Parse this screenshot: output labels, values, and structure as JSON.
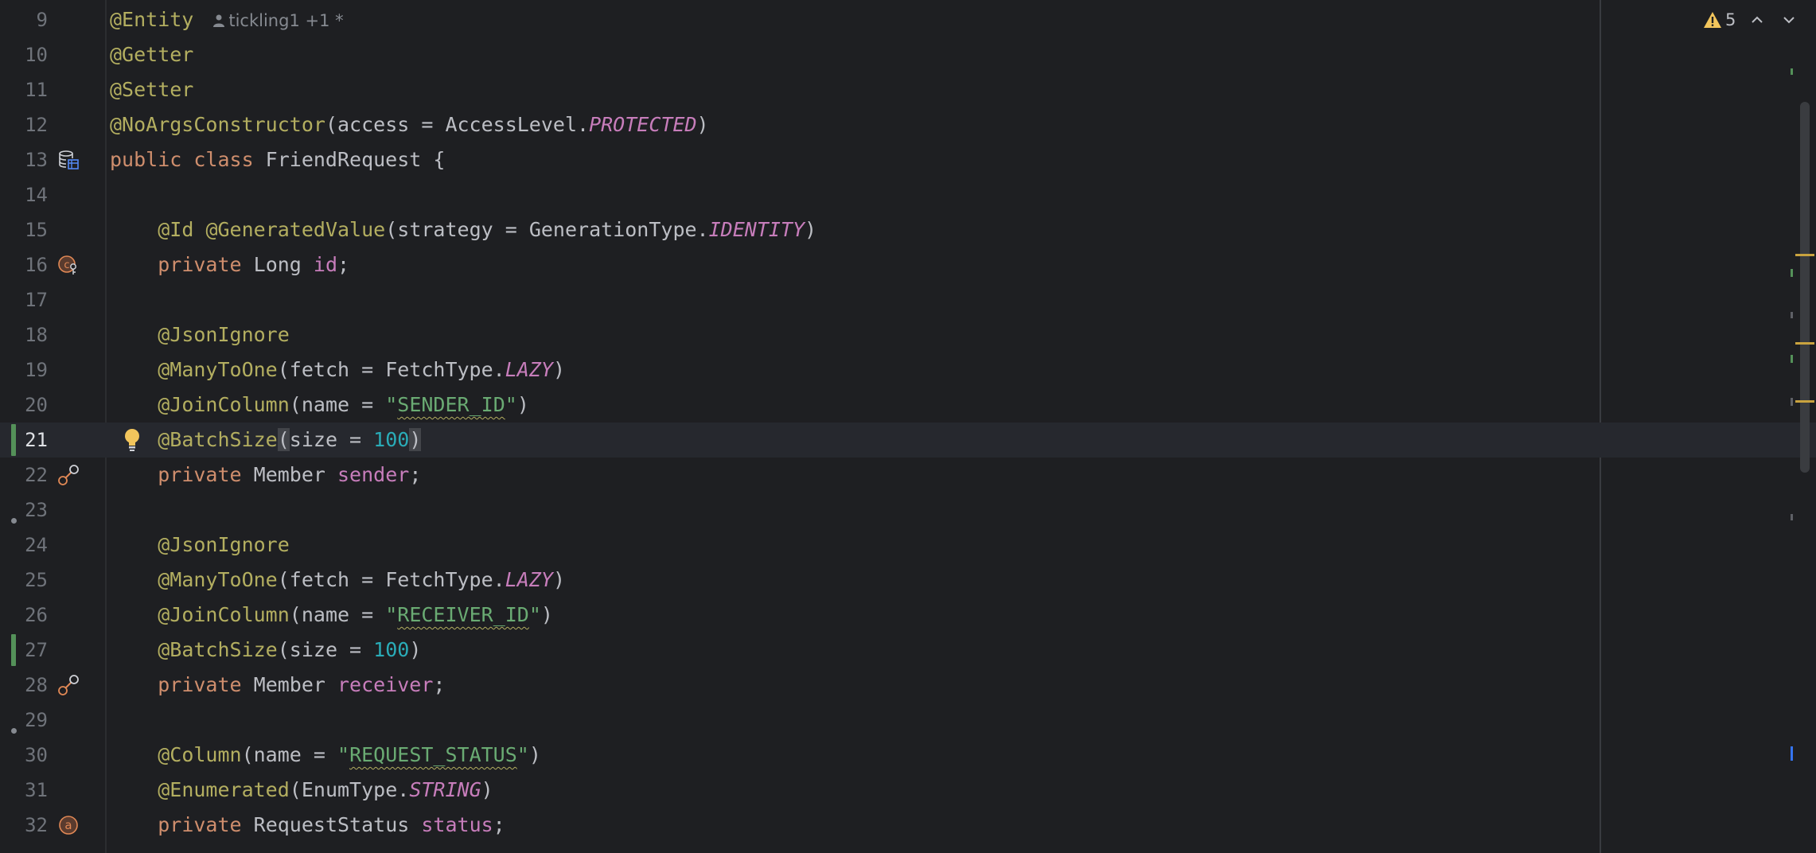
{
  "inlay_hint": "tickling1 +1 *",
  "inspections": {
    "warning_count": "5"
  },
  "lines": [
    {
      "n": "9",
      "tokens": [
        {
          "t": "@Entity",
          "c": "ann"
        }
      ],
      "inlay": true
    },
    {
      "n": "10",
      "tokens": [
        {
          "t": "@Getter",
          "c": "ann"
        }
      ]
    },
    {
      "n": "11",
      "tokens": [
        {
          "t": "@Setter",
          "c": "ann"
        }
      ]
    },
    {
      "n": "12",
      "tokens": [
        {
          "t": "@NoArgsConstructor",
          "c": "ann"
        },
        {
          "t": "(access = AccessLevel.",
          "c": "pun"
        },
        {
          "t": "PROTECTED",
          "c": "enm"
        },
        {
          "t": ")",
          "c": "pun"
        }
      ]
    },
    {
      "n": "13",
      "tokens": [
        {
          "t": "public ",
          "c": "kw"
        },
        {
          "t": "class ",
          "c": "kw"
        },
        {
          "t": "FriendRequest {",
          "c": "cls"
        }
      ],
      "icon": "database-entity-icon"
    },
    {
      "n": "14",
      "tokens": []
    },
    {
      "n": "15",
      "tokens": [
        {
          "t": "    "
        },
        {
          "t": "@Id ",
          "c": "ann"
        },
        {
          "t": "@GeneratedValue",
          "c": "ann"
        },
        {
          "t": "(strategy = GenerationType.",
          "c": "pun"
        },
        {
          "t": "IDENTITY",
          "c": "enm"
        },
        {
          "t": ")",
          "c": "pun"
        }
      ]
    },
    {
      "n": "16",
      "tokens": [
        {
          "t": "    "
        },
        {
          "t": "private ",
          "c": "kw"
        },
        {
          "t": "Long ",
          "c": "cls"
        },
        {
          "t": "id",
          "c": "fld"
        },
        {
          "t": ";",
          "c": "pun"
        }
      ],
      "icon": "id-key-icon"
    },
    {
      "n": "17",
      "tokens": []
    },
    {
      "n": "18",
      "tokens": [
        {
          "t": "    "
        },
        {
          "t": "@JsonIgnore",
          "c": "ann"
        }
      ]
    },
    {
      "n": "19",
      "tokens": [
        {
          "t": "    "
        },
        {
          "t": "@ManyToOne",
          "c": "ann"
        },
        {
          "t": "(fetch = FetchType.",
          "c": "pun"
        },
        {
          "t": "LAZY",
          "c": "enm"
        },
        {
          "t": ")",
          "c": "pun"
        }
      ]
    },
    {
      "n": "20",
      "tokens": [
        {
          "t": "    "
        },
        {
          "t": "@JoinColumn",
          "c": "ann"
        },
        {
          "t": "(name = ",
          "c": "pun"
        },
        {
          "t": "\"",
          "c": "str"
        },
        {
          "t": "SENDER_ID",
          "c": "str squig"
        },
        {
          "t": "\"",
          "c": "str"
        },
        {
          "t": ")",
          "c": "pun"
        }
      ]
    },
    {
      "n": "21",
      "tokens": [
        {
          "t": "    "
        },
        {
          "t": "@BatchSize",
          "c": "ann"
        },
        {
          "t": "(",
          "c": "pun bracket-hl"
        },
        {
          "t": "size = ",
          "c": "pun"
        },
        {
          "t": "100",
          "c": "num"
        },
        {
          "t": ")",
          "c": "pun bracket-hl"
        }
      ],
      "current": true,
      "changed": true,
      "bulb": true
    },
    {
      "n": "22",
      "tokens": [
        {
          "t": "    "
        },
        {
          "t": "private ",
          "c": "kw"
        },
        {
          "t": "Member ",
          "c": "cls"
        },
        {
          "t": "sender",
          "c": "fld"
        },
        {
          "t": ";",
          "c": "pun"
        }
      ],
      "icon": "relation-link-icon"
    },
    {
      "n": "23",
      "tokens": [],
      "dot": true
    },
    {
      "n": "24",
      "tokens": [
        {
          "t": "    "
        },
        {
          "t": "@JsonIgnore",
          "c": "ann"
        }
      ]
    },
    {
      "n": "25",
      "tokens": [
        {
          "t": "    "
        },
        {
          "t": "@ManyToOne",
          "c": "ann"
        },
        {
          "t": "(fetch = FetchType.",
          "c": "pun"
        },
        {
          "t": "LAZY",
          "c": "enm"
        },
        {
          "t": ")",
          "c": "pun"
        }
      ]
    },
    {
      "n": "26",
      "tokens": [
        {
          "t": "    "
        },
        {
          "t": "@JoinColumn",
          "c": "ann"
        },
        {
          "t": "(name = ",
          "c": "pun"
        },
        {
          "t": "\"",
          "c": "str"
        },
        {
          "t": "RECEIVER_ID",
          "c": "str squig"
        },
        {
          "t": "\"",
          "c": "str"
        },
        {
          "t": ")",
          "c": "pun"
        }
      ]
    },
    {
      "n": "27",
      "tokens": [
        {
          "t": "    "
        },
        {
          "t": "@BatchSize",
          "c": "ann"
        },
        {
          "t": "(size = ",
          "c": "pun"
        },
        {
          "t": "100",
          "c": "num"
        },
        {
          "t": ")",
          "c": "pun"
        }
      ],
      "changed": true
    },
    {
      "n": "28",
      "tokens": [
        {
          "t": "    "
        },
        {
          "t": "private ",
          "c": "kw"
        },
        {
          "t": "Member ",
          "c": "cls"
        },
        {
          "t": "receiver",
          "c": "fld"
        },
        {
          "t": ";",
          "c": "pun"
        }
      ],
      "icon": "relation-link-icon"
    },
    {
      "n": "29",
      "tokens": [],
      "dot": true
    },
    {
      "n": "30",
      "tokens": [
        {
          "t": "    "
        },
        {
          "t": "@Column",
          "c": "ann"
        },
        {
          "t": "(name = ",
          "c": "pun"
        },
        {
          "t": "\"",
          "c": "str"
        },
        {
          "t": "REQUEST_STATUS",
          "c": "str squig"
        },
        {
          "t": "\"",
          "c": "str"
        },
        {
          "t": ")",
          "c": "pun"
        }
      ]
    },
    {
      "n": "31",
      "tokens": [
        {
          "t": "    "
        },
        {
          "t": "@Enumerated",
          "c": "ann"
        },
        {
          "t": "(EnumType.",
          "c": "pun"
        },
        {
          "t": "STRING",
          "c": "enm"
        },
        {
          "t": ")",
          "c": "pun"
        }
      ]
    },
    {
      "n": "32",
      "tokens": [
        {
          "t": "    "
        },
        {
          "t": "private ",
          "c": "kw"
        },
        {
          "t": "RequestStatus ",
          "c": "cls"
        },
        {
          "t": "status",
          "c": "fld"
        },
        {
          "t": ";",
          "c": "pun"
        }
      ],
      "icon": "column-a-icon"
    }
  ],
  "colors": {
    "background": "#1e1f22",
    "annotation": "#b3ae60",
    "keyword": "#cf8e6d",
    "field": "#c77dbb",
    "string": "#6aab73",
    "number": "#2aacb8",
    "changed_marker": "#549159",
    "warning": "#f2c55c"
  }
}
